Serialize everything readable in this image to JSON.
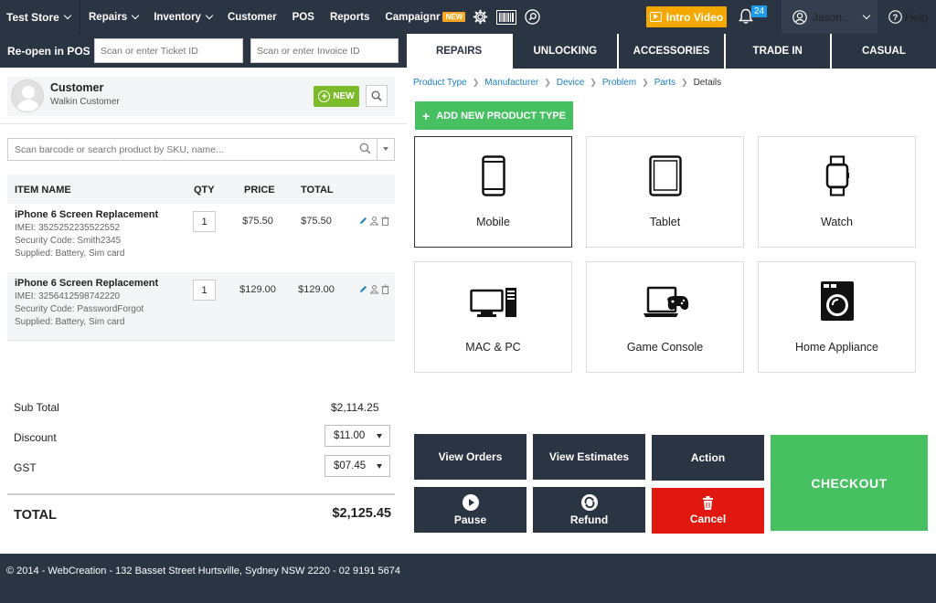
{
  "nav": {
    "store": "Test Store",
    "menu": [
      {
        "label": "Repairs",
        "dropdown": true
      },
      {
        "label": "Inventory",
        "dropdown": true
      },
      {
        "label": "Customer",
        "dropdown": false
      },
      {
        "label": "POS",
        "dropdown": false
      },
      {
        "label": "Reports",
        "dropdown": false
      },
      {
        "label": "Campaignr",
        "dropdown": false,
        "badge": "NEW"
      }
    ],
    "intro_video": "Intro Video",
    "notifications": "24",
    "user": "Jason...",
    "help": "Help"
  },
  "reopen": {
    "label": "Re-open in POS",
    "ticket_placeholder": "Scan or enter Ticket ID",
    "invoice_placeholder": "Scan or enter Invoice ID"
  },
  "customer": {
    "title": "Customer",
    "name": "Walkin Customer",
    "new_label": "NEW"
  },
  "product_search_placeholder": "Scan barcode or search product by SKU, name...",
  "items": {
    "headers": {
      "name": "ITEM NAME",
      "qty": "QTY",
      "price": "PRICE",
      "total": "TOTAL"
    },
    "rows": [
      {
        "name": "iPhone 6 Screen Replacement",
        "imei": "IMEI: 3525252235522552",
        "security": "Security Code: Smith2345",
        "supplied": "Supplied: Battery, Sim card",
        "qty": "1",
        "price": "$75.50",
        "total": "$75.50"
      },
      {
        "name": "iPhone 6 Screen Replacement",
        "imei": "IMEI: 3256412598742220",
        "security": "Security Code: PasswordForgot",
        "supplied": "Supplied: Battery, Sim card",
        "qty": "1",
        "price": "$129.00",
        "total": "$129.00"
      }
    ]
  },
  "totals": {
    "subtotal_label": "Sub Total",
    "subtotal": "$2,114.25",
    "discount_label": "Discount",
    "discount": "$11.00",
    "gst_label": "GST",
    "gst": "$07.45",
    "total_label": "TOTAL",
    "total": "$2,125.45"
  },
  "tabs": [
    {
      "label": "REPAIRS",
      "active": true
    },
    {
      "label": "UNLOCKING",
      "active": false
    },
    {
      "label": "ACCESSORIES",
      "active": false
    },
    {
      "label": "TRADE IN",
      "active": false
    },
    {
      "label": "CASUAL",
      "active": false
    }
  ],
  "breadcrumb": [
    "Product Type",
    "Manufacturer",
    "Device",
    "Problem",
    "Parts",
    "Details"
  ],
  "add_product_type": "ADD NEW PRODUCT TYPE",
  "product_types": [
    {
      "label": "Mobile",
      "icon": "mobile-icon",
      "selected": true
    },
    {
      "label": "Tablet",
      "icon": "tablet-icon",
      "selected": false
    },
    {
      "label": "Watch",
      "icon": "watch-icon",
      "selected": false
    },
    {
      "label": "MAC & PC",
      "icon": "desktop-icon",
      "selected": false
    },
    {
      "label": "Game Console",
      "icon": "game-console-icon",
      "selected": false
    },
    {
      "label": "Home Appliance",
      "icon": "washing-machine-icon",
      "selected": false
    }
  ],
  "actions": {
    "view_orders": "View Orders",
    "view_estimates": "View Estimates",
    "action": "Action",
    "pause": "Pause",
    "refund": "Refund",
    "cancel": "Cancel",
    "checkout": "CHECKOUT"
  },
  "colors": {
    "nav_bg": "#2b3443",
    "accent_green": "#47c062",
    "new_green": "#7cbc2a",
    "cancel_red": "#e0180f",
    "intro_orange": "#f5a800",
    "link_blue": "#1b80c4"
  },
  "footer": "© 2014 - WebCreation - 132 Basset Street Hurtsville, Sydney NSW 2220 - 02 9191 5674"
}
